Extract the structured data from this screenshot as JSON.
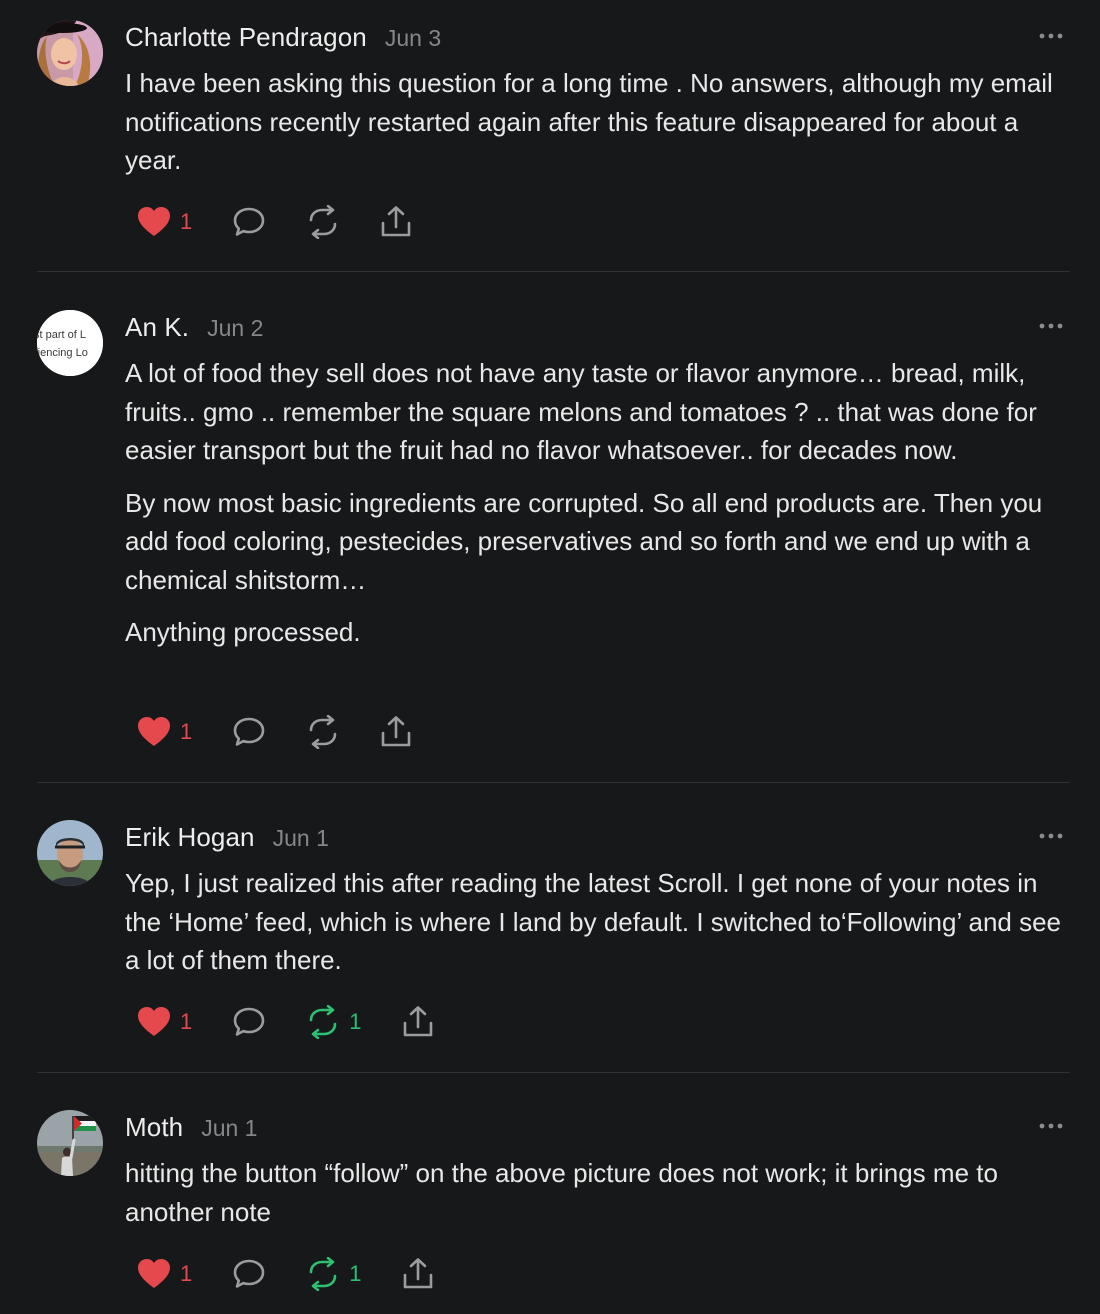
{
  "colors": {
    "background": "#17181a",
    "heart": "#e5484d",
    "restack_active": "#2fbf71",
    "icon_muted": "#9a9ca0"
  },
  "comments": [
    {
      "author": "Charlotte Pendragon",
      "date": "Jun 3",
      "paragraphs": [
        "I have been asking this question for a long time . No answers, although my email notifications recently restarted again after this feature disappeared for about a year."
      ],
      "likes": "1",
      "restacks": "",
      "restack_active": false
    },
    {
      "author": "An K.",
      "date": "Jun 2",
      "avatar_text": [
        "st part of L",
        "riencing Lo"
      ],
      "paragraphs": [
        "A lot of food they sell does not have any taste or flavor anymore… bread, milk, fruits.. gmo .. remember the square melons and tomatoes ? .. that was done for easier transport but the fruit had no flavor whatsoever.. for decades now.",
        "By now most basic ingredients are corrupted. So all end products are. Then you add food coloring, pestecides, preservatives and so forth and we end up with a chemical shitstorm…",
        "Anything processed."
      ],
      "likes": "1",
      "restacks": "",
      "restack_active": false
    },
    {
      "author": "Erik Hogan",
      "date": "Jun 1",
      "paragraphs": [
        "Yep, I just realized this after reading the latest Scroll. I get none of your notes in the ‘Home’ feed, which is where I land by default. I switched to‘Following’ and see a lot of them there."
      ],
      "likes": "1",
      "restacks": "1",
      "restack_active": true
    },
    {
      "author": "Moth",
      "date": "Jun 1",
      "paragraphs": [
        "hitting the button “follow” on the above picture does not work; it brings me to another note"
      ],
      "likes": "1",
      "restacks": "1",
      "restack_active": true
    }
  ],
  "icons": {
    "like": "heart-icon",
    "reply": "speech-bubble-icon",
    "restack": "restack-arrows-icon",
    "share": "share-upload-icon",
    "more": "ellipsis-icon"
  }
}
